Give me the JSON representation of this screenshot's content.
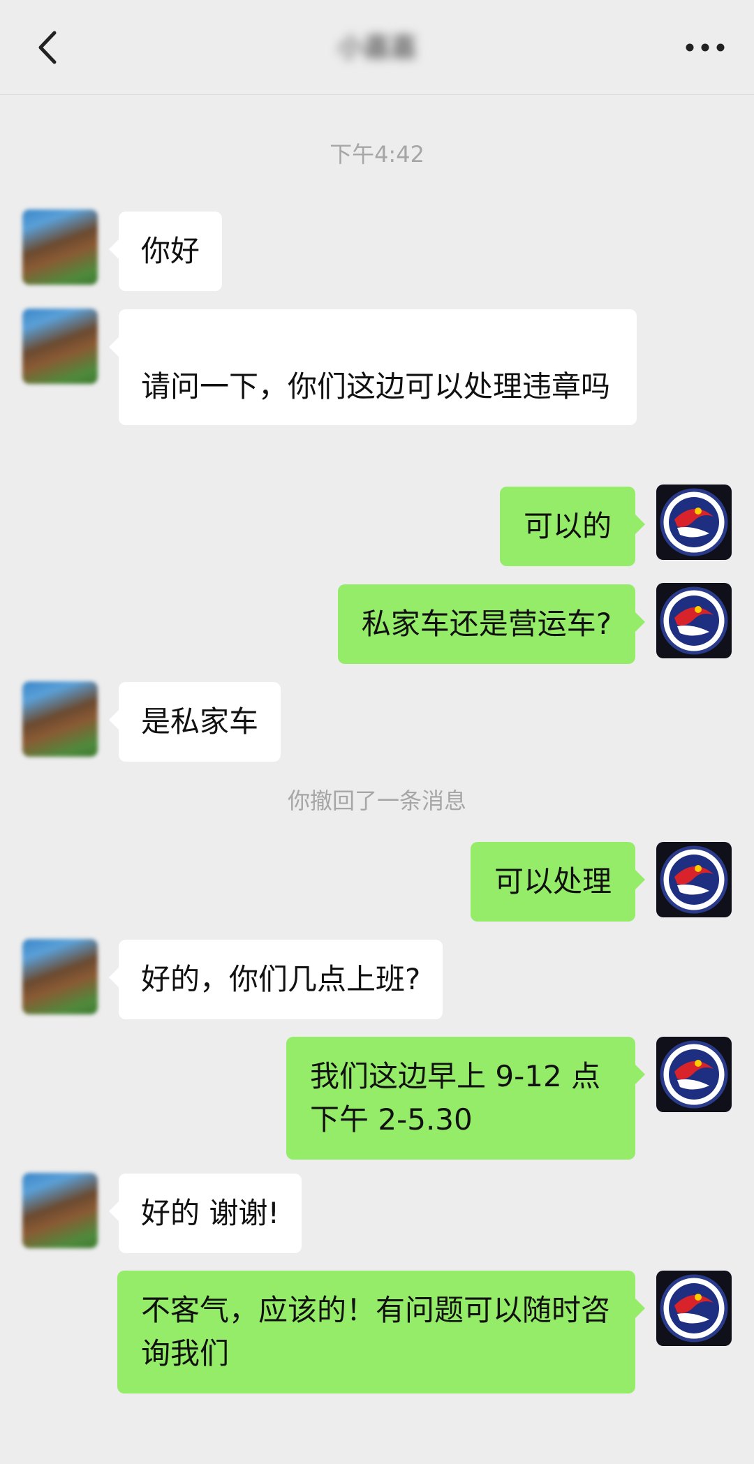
{
  "header": {
    "back_icon": "chevron-left-icon",
    "title": "小嘉嘉",
    "more_icon": "more-dots-icon"
  },
  "timestamp": "下午4:42",
  "recall_notice": "你撤回了一条消息",
  "messages": [
    {
      "from": "peer",
      "text": "你好"
    },
    {
      "from": "peer",
      "text": "请问一下，你们这边可以处理违章吗"
    },
    {
      "from": "me",
      "text": "可以的"
    },
    {
      "from": "me",
      "text": "私家车还是营运车?"
    },
    {
      "from": "peer",
      "text": "是私家车"
    },
    {
      "from": "me",
      "text": "可以处理"
    },
    {
      "from": "peer",
      "text": "好的，你们几点上班?"
    },
    {
      "from": "me",
      "text": "我们这边早上 9-12 点下午 2-5.30"
    },
    {
      "from": "peer",
      "text": "好的 谢谢!"
    },
    {
      "from": "me",
      "text": "不客气，应该的！有问题可以随时咨询我们"
    }
  ],
  "colors": {
    "background": "#ededed",
    "sent_bubble": "#95ec69",
    "received_bubble": "#ffffff",
    "system_text": "#a6a6a6"
  }
}
